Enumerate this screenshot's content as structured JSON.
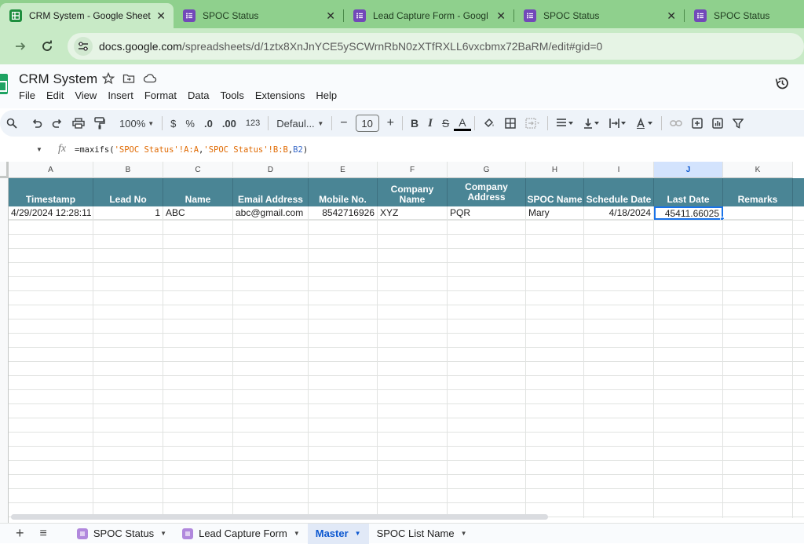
{
  "browser": {
    "tabs": [
      {
        "title": "CRM System - Google Sheet",
        "icon": "sheets-icon",
        "active": true
      },
      {
        "title": "SPOC Status",
        "icon": "forms-icon",
        "active": false
      },
      {
        "title": "Lead Capture Form - Googl",
        "icon": "forms-icon",
        "active": false
      },
      {
        "title": "SPOC Status",
        "icon": "forms-icon",
        "active": false
      },
      {
        "title": "SPOC Status",
        "icon": "forms-icon",
        "active": false
      }
    ],
    "close_glyph": "✕",
    "url_host": "docs.google.com",
    "url_path": "/spreadsheets/d/1ztx8XnJnYCE5ySCWrnRbN0zXTfRXLL6vxcbmx72BaRM/edit#gid=0"
  },
  "doc": {
    "title": "CRM System",
    "menu": [
      "File",
      "Edit",
      "View",
      "Insert",
      "Format",
      "Data",
      "Tools",
      "Extensions",
      "Help"
    ]
  },
  "toolbar": {
    "zoom": "100%",
    "currency": "$",
    "percent": "%",
    "dec_decrease": ".0",
    "dec_increase": ".00",
    "number_format": "123",
    "font": "Defaul...",
    "minus": "−",
    "font_size": "10",
    "plus": "+",
    "bold": "B",
    "italic": "I",
    "strike": "S",
    "text_color": "A"
  },
  "formula_bar": {
    "fx": "fx",
    "parts": [
      "=maxifs(",
      "'SPOC Status'!A:A",
      ",",
      "'SPOC Status'!B:B",
      ",",
      "B2",
      ")"
    ]
  },
  "grid": {
    "column_letters": [
      "A",
      "B",
      "C",
      "D",
      "E",
      "F",
      "G",
      "H",
      "I",
      "J",
      "K"
    ],
    "selected_column": "J",
    "headers": [
      "Timestamp",
      "Lead No",
      "Name",
      "Email Address",
      "Mobile No.",
      "Company Name",
      "Company Address",
      "SPOC Name",
      "Schedule Date",
      "Last Date",
      "Remarks"
    ],
    "row": [
      "4/29/2024 12:28:11",
      "1",
      "ABC",
      "abc@gmail.com",
      "8542716926",
      "XYZ",
      "PQR",
      "Mary",
      "4/18/2024",
      "45411.66025",
      ""
    ],
    "header_color": "#4a8595"
  },
  "sheet_tabs": {
    "add": "+",
    "all_sheets": "≡",
    "tabs": [
      {
        "label": "SPOC Status",
        "has_form_icon": true,
        "active": false
      },
      {
        "label": "Lead Capture Form",
        "has_form_icon": true,
        "active": false
      },
      {
        "label": "Master",
        "has_form_icon": false,
        "active": true
      },
      {
        "label": "SPOC List Name",
        "has_form_icon": false,
        "active": false
      }
    ]
  }
}
